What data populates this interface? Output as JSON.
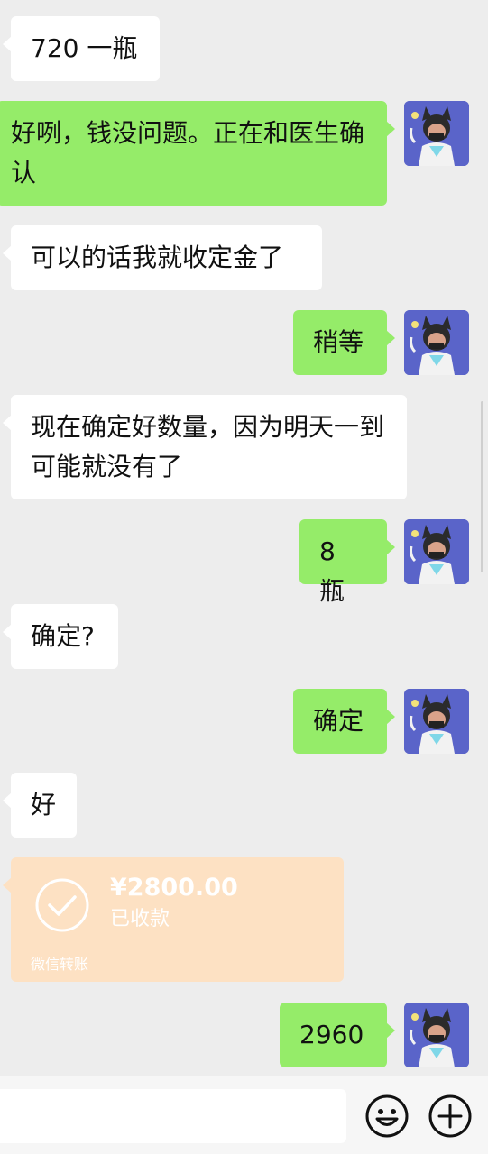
{
  "messages": [
    {
      "side": "in",
      "text": "720 一瓶"
    },
    {
      "side": "out",
      "text": "好咧，钱没问题。正在和医生确认"
    },
    {
      "side": "in",
      "text": "可以的话我就收定金了"
    },
    {
      "side": "out",
      "text": "稍等"
    },
    {
      "side": "in",
      "text": "现在确定好数量，因为明天一到可能就没有了"
    },
    {
      "side": "out",
      "text": "8 瓶"
    },
    {
      "side": "in",
      "text": "确定?"
    },
    {
      "side": "out",
      "text": "确定"
    },
    {
      "side": "in",
      "text": "好"
    },
    {
      "side": "out",
      "text": "2960"
    }
  ],
  "transfer": {
    "amount": "¥2800.00",
    "status": "已收款",
    "label": "微信转账",
    "icon": "check-circle-icon",
    "color": "#fde1c3"
  },
  "input_bar": {
    "value": "",
    "emoji_icon": "emoji-icon",
    "plus_icon": "plus-icon"
  },
  "colors": {
    "background": "#ededed",
    "incoming_bubble": "#ffffff",
    "outgoing_bubble": "#95ec69",
    "avatar_bg": "#5a64c9"
  }
}
